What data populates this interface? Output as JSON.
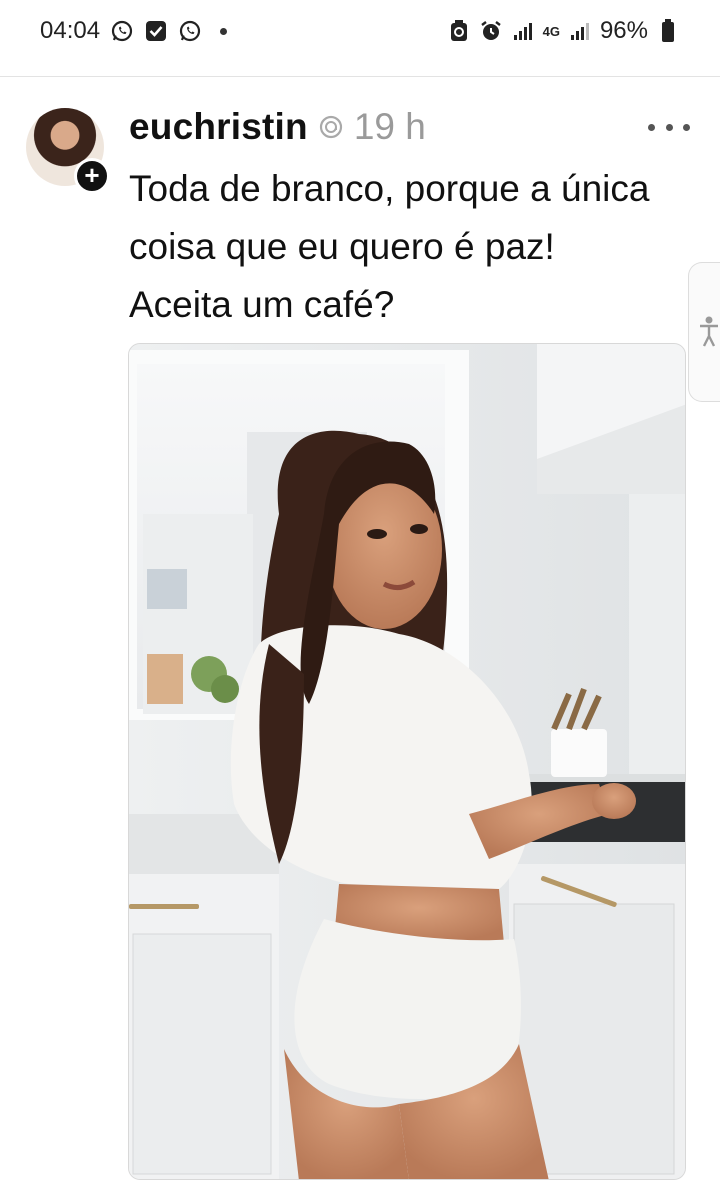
{
  "status_bar": {
    "time": "04:04",
    "left_icons": [
      "whatsapp-icon",
      "checkbox-icon",
      "whatsapp-icon"
    ],
    "network_type": "4G",
    "battery": "96%"
  },
  "post": {
    "username": "euchristin",
    "time_ago": "19 h",
    "caption": "Toda de branco, porque a única coisa que eu quero é paz! Aceita um café?",
    "follow_symbol": "+",
    "image_description_icon": "photo"
  },
  "colors": {
    "text": "#111111",
    "muted": "#9a9a9a",
    "divider": "#e3e3e3"
  }
}
